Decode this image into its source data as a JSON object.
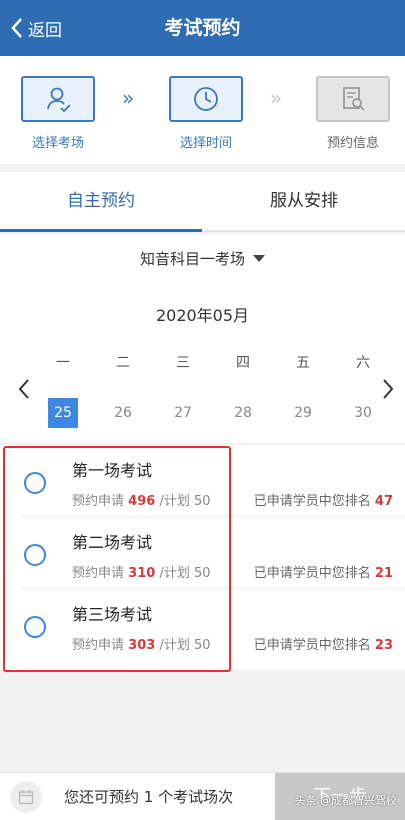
{
  "header": {
    "back_label": "返回",
    "title": "考试预约"
  },
  "steps": [
    {
      "label": "选择考场",
      "icon": "person-check-icon",
      "active": true
    },
    {
      "label": "选择时间",
      "icon": "clock-icon",
      "active": true
    },
    {
      "label": "预约信息",
      "icon": "document-search-icon",
      "active": false
    }
  ],
  "tabs": {
    "active": "自主预约",
    "other": "服从安排"
  },
  "subject": {
    "selected": "知音科目一考场"
  },
  "calendar": {
    "month": "2020年05月",
    "weekdays": [
      "一",
      "二",
      "三",
      "四",
      "五",
      "六"
    ],
    "dates": [
      "25",
      "26",
      "27",
      "28",
      "29",
      "30"
    ],
    "selected_date": "25"
  },
  "sessions": [
    {
      "name": "第一场考试",
      "applied_label": "预约申请",
      "applied": "496",
      "plan_label": "/计划",
      "plan": "50",
      "rank_label": "已申请学员中您排名",
      "rank": "47"
    },
    {
      "name": "第二场考试",
      "applied_label": "预约申请",
      "applied": "310",
      "plan_label": "/计划",
      "plan": "50",
      "rank_label": "已申请学员中您排名",
      "rank": "21"
    },
    {
      "name": "第三场考试",
      "applied_label": "预约申请",
      "applied": "303",
      "plan_label": "/计划",
      "plan": "50",
      "rank_label": "已申请学员中您排名",
      "rank": "23"
    }
  ],
  "footer": {
    "remaining_text": "您还可预约 1 个考试场次",
    "next_label": "下一步"
  },
  "watermark": "头条 @成都智兴驾校",
  "colors": {
    "primary": "#2f6db2",
    "accent": "#3b88de",
    "highlight_red": "#e03030",
    "number_red": "#d83a3a",
    "disabled": "#c8c8c8"
  }
}
